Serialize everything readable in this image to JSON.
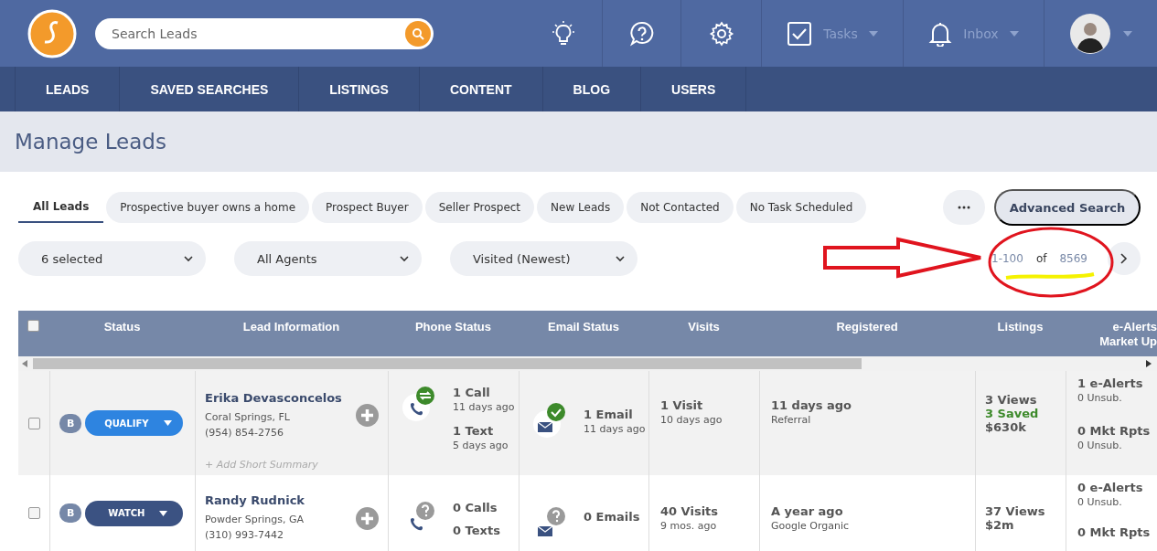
{
  "header": {
    "search": {
      "placeholder": "Search Leads"
    },
    "tasks": {
      "label": "Tasks"
    },
    "inbox": {
      "label": "Inbox"
    }
  },
  "nav": [
    {
      "label": "LEADS"
    },
    {
      "label": "SAVED SEARCHES"
    },
    {
      "label": "LISTINGS"
    },
    {
      "label": "CONTENT"
    },
    {
      "label": "BLOG"
    },
    {
      "label": "USERS"
    }
  ],
  "page_title": "Manage Leads",
  "filter_tabs": [
    {
      "label": "All Leads",
      "selected": true
    },
    {
      "label": "Prospective buyer owns a home",
      "selected": false
    },
    {
      "label": "Prospect Buyer",
      "selected": false
    },
    {
      "label": "Seller Prospect",
      "selected": false
    },
    {
      "label": "New Leads",
      "selected": false
    },
    {
      "label": "Not Contacted",
      "selected": false
    },
    {
      "label": "No Task Scheduled",
      "selected": false
    }
  ],
  "advanced_search": "Advanced Search",
  "filters": [
    {
      "value": "6 selected"
    },
    {
      "value": "All Agents"
    },
    {
      "value": "Visited (Newest)"
    }
  ],
  "pagination": {
    "range": "1-100",
    "of": "of",
    "total": "8569"
  },
  "table": {
    "select_all": {
      "checked": false
    },
    "columns": [
      {
        "lines": [
          "Status"
        ]
      },
      {
        "lines": [
          "Lead Information"
        ]
      },
      {
        "lines": [
          "Phone Status"
        ]
      },
      {
        "lines": [
          "Email Status"
        ]
      },
      {
        "lines": [
          "Visits"
        ]
      },
      {
        "lines": [
          "Registered"
        ]
      },
      {
        "lines": [
          "Listings"
        ]
      },
      {
        "lines": [
          "e-Alerts",
          "Market Up"
        ]
      }
    ],
    "rows": [
      {
        "checked": false,
        "grade": "B",
        "status": "QUALIFY",
        "color": "#2e84e0",
        "name": "Erika Devasconcelos",
        "location": "Coral Springs, FL",
        "phone": "(954) 854-2756",
        "summary": "+ Add Short Summary",
        "phone_status": {
          "kind": "active",
          "calls": "1 Call",
          "calls_when": "11 days ago",
          "texts": "1 Text",
          "texts_when": "5 days ago"
        },
        "email_status": {
          "kind": "sent",
          "emails": "1 Email",
          "emails_when": "11 days ago"
        },
        "visits": "1 Visit",
        "visits_when": "10 days ago",
        "registered": "11 days ago",
        "source": "Referral",
        "views": "3 Views",
        "saved": "3 Saved",
        "price": "$630k",
        "alerts": "1 e-Alerts",
        "alerts_unsub": "0 Unsub.",
        "reports": "0 Mkt Rpts",
        "reports_unsub": "0 Unsub."
      },
      {
        "checked": false,
        "grade": "B",
        "status": "WATCH",
        "color": "#3b5282",
        "name": "Randy Rudnick",
        "location": "Powder Springs, GA",
        "phone": "(310) 993-7442",
        "phone_status": {
          "kind": "unknown",
          "calls": "0 Calls",
          "texts": "0 Texts"
        },
        "email_status": {
          "kind": "unknown",
          "emails": "0 Emails"
        },
        "visits": "40 Visits",
        "visits_when": "9 mos. ago",
        "registered": "A year ago",
        "source": "Google Organic",
        "views": "37 Views",
        "price": "$2m",
        "alerts": "0 e-Alerts",
        "alerts_unsub": "0 Unsub.",
        "reports": "0 Mkt Rpts"
      }
    ]
  }
}
